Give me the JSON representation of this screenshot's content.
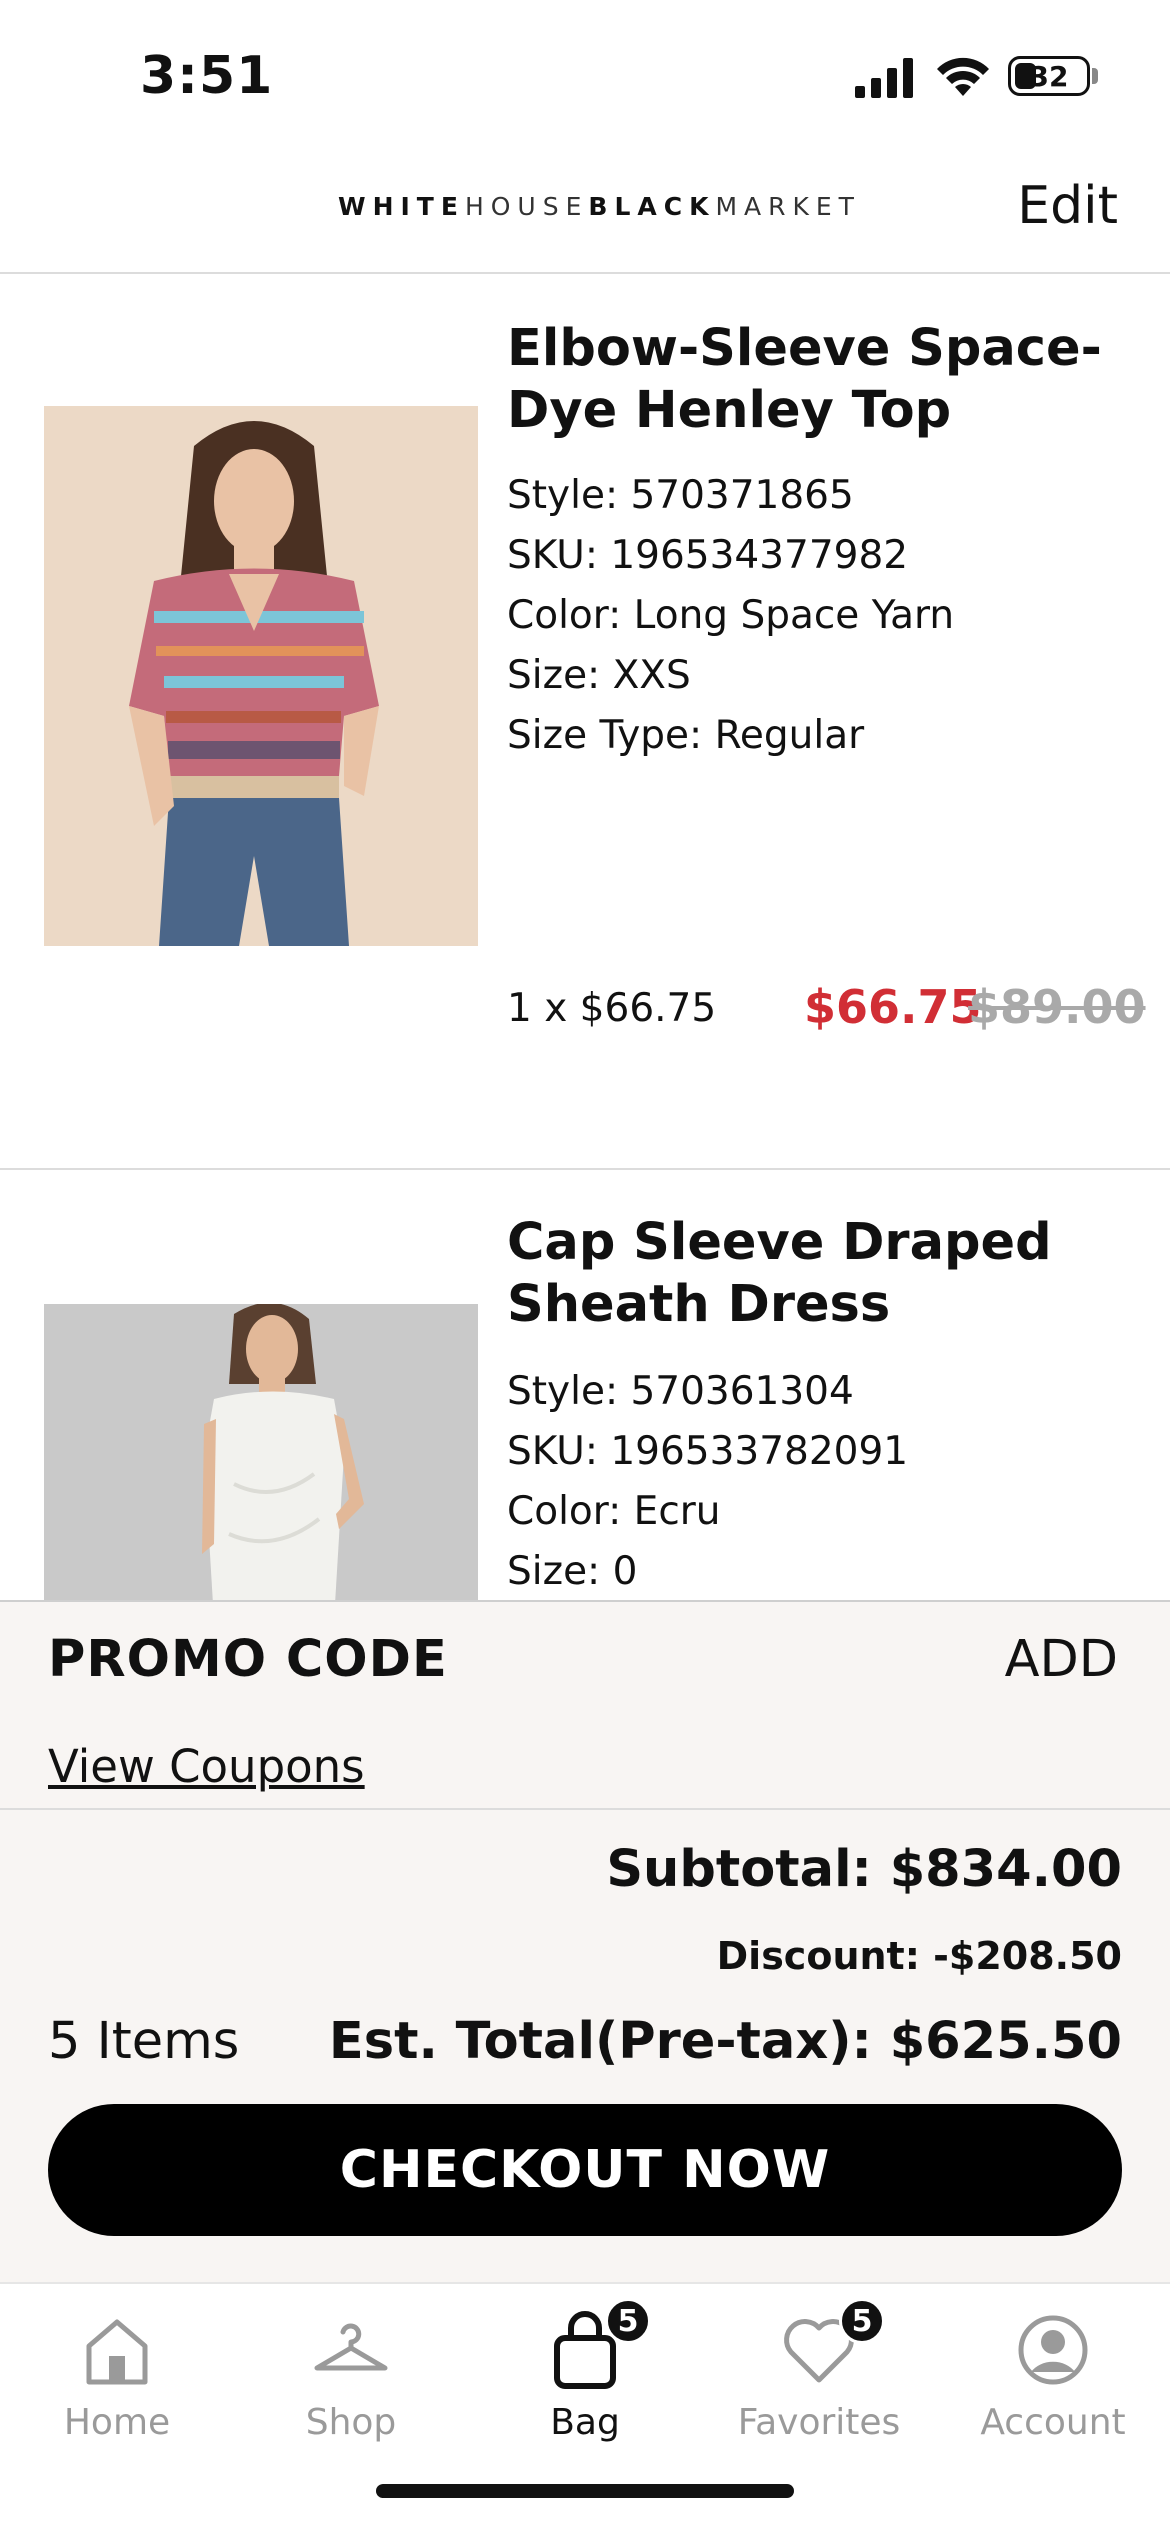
{
  "status_bar": {
    "time": "3:51",
    "battery": "32"
  },
  "header": {
    "brand": {
      "word1": "WHITE",
      "word2": "HOUSE",
      "word3": "BLACK",
      "word4": "MARKET"
    },
    "edit_label": "Edit"
  },
  "items": [
    {
      "title": "Elbow-Sleeve Space-Dye Henley Top",
      "style": "Style: 570371865",
      "sku": "SKU: 196534377982",
      "color": "Color: Long Space Yarn",
      "size": "Size: XXS",
      "size_type": "Size Type: Regular",
      "qty_price": "1 x $66.75",
      "sale_price": "$66.75",
      "original_price": "$89.00"
    },
    {
      "title": "Cap Sleeve Draped Sheath Dress",
      "style": "Style: 570361304",
      "sku": "SKU: 196533782091",
      "color": "Color: Ecru",
      "size": "Size: 0"
    }
  ],
  "summary": {
    "promo_label": "PROMO CODE",
    "promo_add": "ADD",
    "view_coupons": "View Coupons",
    "subtotal": "Subtotal: $834.00",
    "discount": "Discount: -$208.50",
    "item_count": "5 Items",
    "est_total": "Est. Total(Pre-tax): $625.50",
    "checkout_label": "CHECKOUT NOW"
  },
  "tabs": [
    {
      "label": "Home",
      "icon": "home-icon"
    },
    {
      "label": "Shop",
      "icon": "hanger-icon"
    },
    {
      "label": "Bag",
      "icon": "bag-icon",
      "badge": "5",
      "active": true
    },
    {
      "label": "Favorites",
      "icon": "heart-icon",
      "badge": "5"
    },
    {
      "label": "Account",
      "icon": "account-icon"
    }
  ],
  "colors": {
    "sale": "#d12e35",
    "original_price": "#a9a9a9",
    "sheet_background": "#f8f5f3",
    "button": "#000000",
    "inactive_tab": "#9a9a9a"
  }
}
